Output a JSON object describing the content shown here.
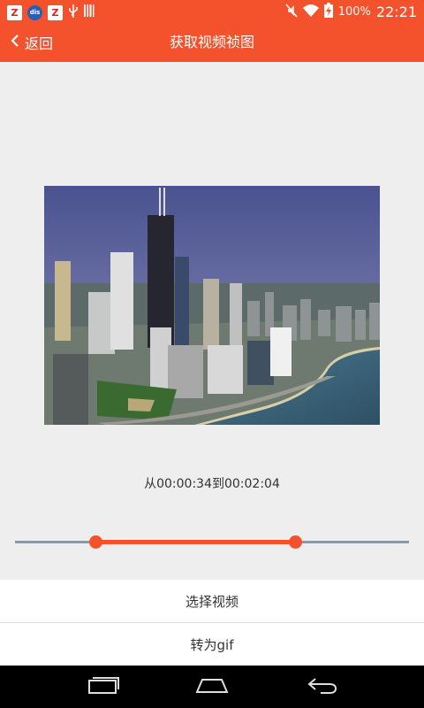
{
  "status_bar": {
    "battery_text": "100%",
    "time": "22:21",
    "icons": [
      "z-app-icon",
      "badge-app-icon",
      "z-app-icon",
      "usb-icon",
      "barcode-icon",
      "mute-icon",
      "wifi-icon",
      "battery-charging-icon"
    ]
  },
  "app_bar": {
    "back_label": "返回",
    "title": "获取视频祯图"
  },
  "video": {
    "content": "aerial city skyline by the lake"
  },
  "range": {
    "text": "从00:00:34到00:02:04",
    "start_fraction": 0.21,
    "end_fraction": 0.71
  },
  "actions": {
    "select_video": "选择视频",
    "convert_gif": "转为gif"
  },
  "colors": {
    "accent": "#f4522d",
    "track": "#8a99aa",
    "background": "#eeeeee"
  },
  "nav_bar": {
    "icons": [
      "recents-icon",
      "home-icon",
      "back-icon"
    ]
  }
}
